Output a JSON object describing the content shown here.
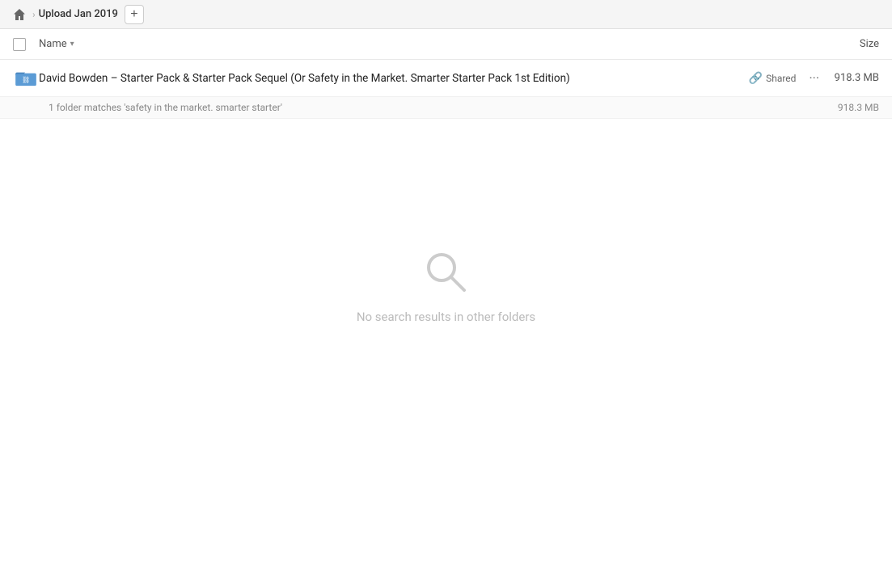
{
  "header": {
    "home_label": "Home",
    "breadcrumb_label": "Upload Jan 2019",
    "add_button_label": "+"
  },
  "toolbar": {
    "name_label": "Name",
    "sort_arrow": "▾",
    "size_label": "Size"
  },
  "file_row": {
    "name": "David Bowden – Starter Pack & Starter Pack Sequel (Or Safety in the Market. Smarter Starter Pack 1st Edition)",
    "shared_label": "Shared",
    "size": "918.3 MB"
  },
  "match_row": {
    "text": "1 folder matches 'safety in the market. smarter starter'",
    "size": "918.3 MB"
  },
  "empty_state": {
    "text": "No search results in other folders"
  }
}
